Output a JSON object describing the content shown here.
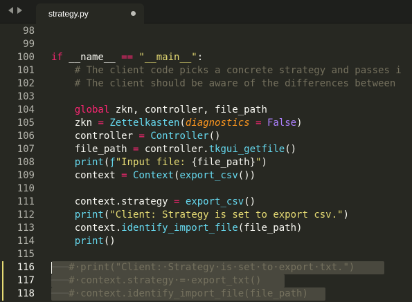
{
  "tab": {
    "title": "strategy.py"
  },
  "colors": {
    "background": "#272822",
    "tabbar": "#1e1f1c",
    "keyword": "#f92672",
    "builtin": "#66d9ef",
    "string": "#e6db74",
    "comment": "#75715e",
    "argument": "#fd971f",
    "constant": "#ae81ff",
    "selection": "#49483e",
    "gutter_modified": "#e6db74"
  },
  "icons": [
    "arrow-left-icon",
    "arrow-right-icon",
    "unsaved-dot-icon"
  ],
  "lines": [
    {
      "number": "98",
      "tokens": []
    },
    {
      "number": "99",
      "tokens": []
    },
    {
      "number": "100",
      "tokens": [
        {
          "t": "kw",
          "v": "if"
        },
        {
          "t": "plain",
          "v": " __name__ "
        },
        {
          "t": "op",
          "v": "=="
        },
        {
          "t": "plain",
          "v": " "
        },
        {
          "t": "str",
          "v": "\"__main__\""
        },
        {
          "t": "plain",
          "v": ":"
        }
      ]
    },
    {
      "number": "101",
      "tokens": [
        {
          "t": "plain",
          "v": "    "
        },
        {
          "t": "cm",
          "v": "# The client code picks a concrete strategy and passes i"
        }
      ]
    },
    {
      "number": "102",
      "tokens": [
        {
          "t": "plain",
          "v": "    "
        },
        {
          "t": "cm",
          "v": "# The client should be aware of the differences between"
        }
      ]
    },
    {
      "number": "103",
      "tokens": []
    },
    {
      "number": "104",
      "tokens": [
        {
          "t": "plain",
          "v": "    "
        },
        {
          "t": "kw",
          "v": "global"
        },
        {
          "t": "plain",
          "v": " zkn, controller, file_path"
        }
      ]
    },
    {
      "number": "105",
      "tokens": [
        {
          "t": "plain",
          "v": "    zkn "
        },
        {
          "t": "op",
          "v": "="
        },
        {
          "t": "plain",
          "v": " "
        },
        {
          "t": "fn",
          "v": "Zettelkasten"
        },
        {
          "t": "plain",
          "v": "("
        },
        {
          "t": "arg",
          "v": "diagnostics"
        },
        {
          "t": "plain",
          "v": " "
        },
        {
          "t": "op",
          "v": "="
        },
        {
          "t": "plain",
          "v": " "
        },
        {
          "t": "const",
          "v": "False"
        },
        {
          "t": "plain",
          "v": ")"
        }
      ]
    },
    {
      "number": "106",
      "tokens": [
        {
          "t": "plain",
          "v": "    controller "
        },
        {
          "t": "op",
          "v": "="
        },
        {
          "t": "plain",
          "v": " "
        },
        {
          "t": "fn",
          "v": "Controller"
        },
        {
          "t": "plain",
          "v": "()"
        }
      ]
    },
    {
      "number": "107",
      "tokens": [
        {
          "t": "plain",
          "v": "    file_path "
        },
        {
          "t": "op",
          "v": "="
        },
        {
          "t": "plain",
          "v": " controller."
        },
        {
          "t": "fn",
          "v": "tkgui_getfile"
        },
        {
          "t": "plain",
          "v": "()"
        }
      ]
    },
    {
      "number": "108",
      "tokens": [
        {
          "t": "plain",
          "v": "    "
        },
        {
          "t": "fn",
          "v": "print"
        },
        {
          "t": "plain",
          "v": "("
        },
        {
          "t": "kw2",
          "v": "ƒ"
        },
        {
          "t": "str",
          "v": "\"Input file: "
        },
        {
          "t": "plain",
          "v": "{file_path}"
        },
        {
          "t": "str",
          "v": "\""
        },
        {
          "t": "plain",
          "v": ")"
        }
      ]
    },
    {
      "number": "109",
      "tokens": [
        {
          "t": "plain",
          "v": "    context "
        },
        {
          "t": "op",
          "v": "="
        },
        {
          "t": "plain",
          "v": " "
        },
        {
          "t": "fn",
          "v": "Context"
        },
        {
          "t": "plain",
          "v": "("
        },
        {
          "t": "fn",
          "v": "export_csv"
        },
        {
          "t": "plain",
          "v": "())"
        }
      ]
    },
    {
      "number": "110",
      "tokens": []
    },
    {
      "number": "111",
      "tokens": [
        {
          "t": "plain",
          "v": "    context.strategy "
        },
        {
          "t": "op",
          "v": "="
        },
        {
          "t": "plain",
          "v": " "
        },
        {
          "t": "fn",
          "v": "export_csv"
        },
        {
          "t": "plain",
          "v": "()"
        }
      ]
    },
    {
      "number": "112",
      "tokens": [
        {
          "t": "plain",
          "v": "    "
        },
        {
          "t": "fn",
          "v": "print"
        },
        {
          "t": "plain",
          "v": "("
        },
        {
          "t": "str",
          "v": "\"Client: Strategy is set to export csv.\""
        },
        {
          "t": "plain",
          "v": ")"
        }
      ]
    },
    {
      "number": "113",
      "tokens": [
        {
          "t": "plain",
          "v": "    context."
        },
        {
          "t": "fn",
          "v": "identify_import_file"
        },
        {
          "t": "plain",
          "v": "(file_path)"
        }
      ]
    },
    {
      "number": "114",
      "tokens": [
        {
          "t": "plain",
          "v": "    "
        },
        {
          "t": "fn",
          "v": "print"
        },
        {
          "t": "plain",
          "v": "()"
        }
      ]
    },
    {
      "number": "115",
      "tokens": []
    },
    {
      "number": "116",
      "modified": true,
      "caret": true,
      "tokens": [
        {
          "t": "ws",
          "v": "───"
        },
        {
          "t": "cm",
          "v": "#·print(\"Client:·Strategy·is·set·to·export·txt.\")"
        }
      ]
    },
    {
      "number": "117",
      "modified": true,
      "tokens": [
        {
          "t": "ws",
          "v": "───"
        },
        {
          "t": "cm",
          "v": "#·context.strategy·=·export_txt()"
        }
      ]
    },
    {
      "number": "118",
      "modified": true,
      "tokens": [
        {
          "t": "ws",
          "v": "───"
        },
        {
          "t": "cm",
          "v": "#·context.identify_import_file(file_path)"
        }
      ]
    }
  ]
}
